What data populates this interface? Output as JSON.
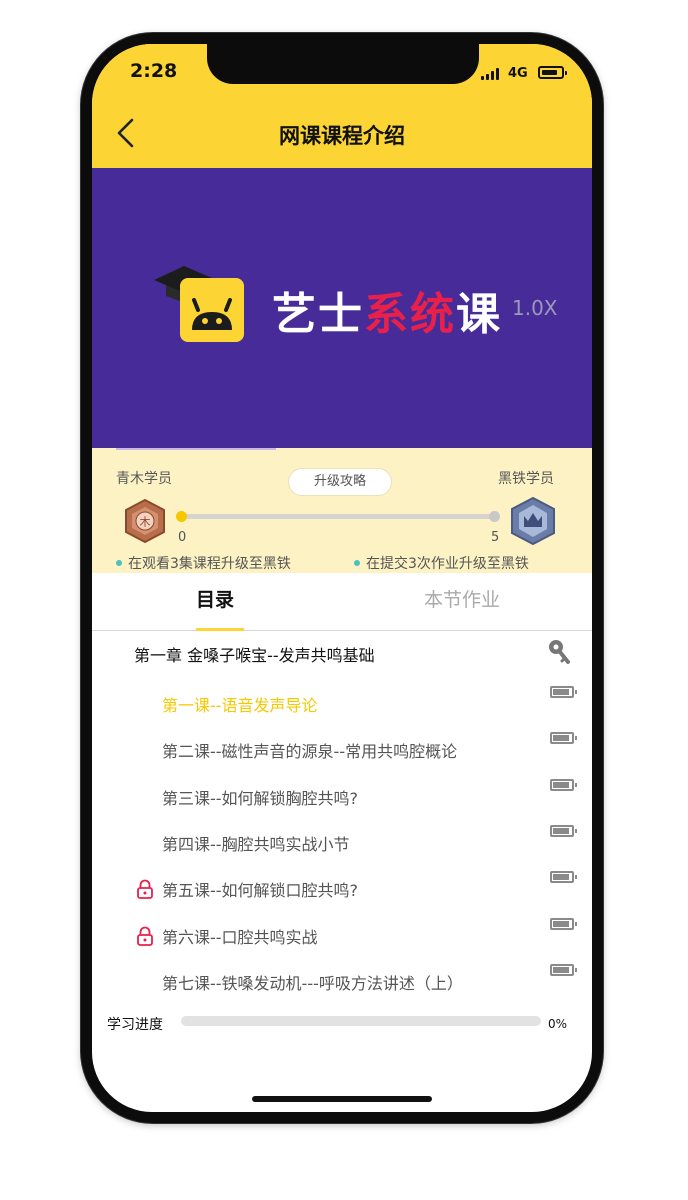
{
  "status": {
    "time": "2:28",
    "network": "4G"
  },
  "header": {
    "title": "网课课程介绍"
  },
  "video": {
    "brand_left": "艺",
    "brand_mid": "士",
    "brand_red": "系统",
    "brand_right": "课",
    "speed": "1.0X"
  },
  "upgrade": {
    "current_level": "青木学员",
    "next_level": "黑铁学员",
    "button": "升级攻略",
    "progress_start": "0",
    "progress_end": "5",
    "tip_watch": "在观看3集课程升级至黑铁",
    "tip_homework": "在提交3次作业升级至黑铁",
    "badge_char": "木"
  },
  "tabs": [
    {
      "label": "目录"
    },
    {
      "label": "本节作业"
    }
  ],
  "chapter": {
    "title": "第一章 金嗓子喉宝--发声共鸣基础"
  },
  "lessons": [
    {
      "title": "第一课--语音发声导论",
      "locked": false,
      "active": true
    },
    {
      "title": "第二课--磁性声音的源泉--常用共鸣腔概论",
      "locked": false,
      "active": false
    },
    {
      "title": "第三课--如何解锁胸腔共鸣?",
      "locked": false,
      "active": false
    },
    {
      "title": "第四课--胸腔共鸣实战小节",
      "locked": false,
      "active": false
    },
    {
      "title": "第五课--如何解锁口腔共鸣?",
      "locked": true,
      "active": false
    },
    {
      "title": "第六课--口腔共鸣实战",
      "locked": true,
      "active": false
    },
    {
      "title": "第七课--铁嗓发动机---呼吸方法讲述（上）",
      "locked": false,
      "active": false
    }
  ],
  "progress": {
    "label": "学习进度",
    "percent_text": "0%",
    "value": 0
  },
  "colors": {
    "accent": "#fcd535",
    "video_bg": "#472c99",
    "lock": "#e8204a",
    "active_lesson": "#f7c800"
  }
}
